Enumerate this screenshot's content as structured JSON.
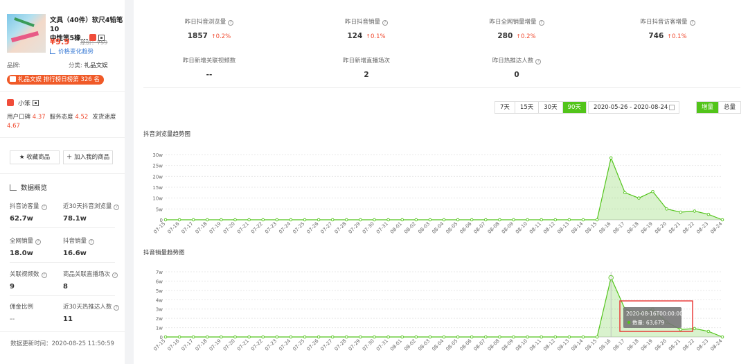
{
  "product": {
    "title_line1": "文具（40件）软尺4铅笔10",
    "title_line2": "中性笔5橡...",
    "price": "¥9.9",
    "orig_price": "原价：¥59",
    "price_trend_label": "价格变化趋势"
  },
  "brand": {
    "label": "品牌:",
    "category_label": "分类:",
    "category": "礼品文娱"
  },
  "rank_badge": "礼品文娱 排行榜日榜第 326 名",
  "shop": {
    "name": "小笨",
    "score_label_1": "用户口碑",
    "score_1": "4.37",
    "score_label_2": "服务态度",
    "score_2": "4.52",
    "score_label_3": "发货速度",
    "score_3": "4.67"
  },
  "buttons": {
    "favorite": "★ 收藏商品",
    "add": "＋ 加入我的商品"
  },
  "overview": {
    "title": "数据概览",
    "stats": [
      {
        "label": "抖音访客量",
        "value": "62.7w",
        "q": true
      },
      {
        "label": "近30天抖音浏览量",
        "value": "78.1w",
        "q": true
      },
      {
        "label": "全网销量",
        "value": "18.0w",
        "q": true
      },
      {
        "label": "抖音销量",
        "value": "16.6w",
        "q": true
      },
      {
        "label": "关联视频数",
        "value": "9",
        "q": true
      },
      {
        "label": "商品关联直播场次",
        "value": "8",
        "q": true
      },
      {
        "label": "佣金比例",
        "value": "--",
        "q": false
      },
      {
        "label": "近30天热推达人数",
        "value": "11",
        "q": true
      }
    ],
    "updated": "数据更新时间：2020-08-25 11:50:59"
  },
  "topstats": [
    {
      "label": "昨日抖音浏览量",
      "value": "1857",
      "pct": "0.2%",
      "q": true
    },
    {
      "label": "昨日抖音销量",
      "value": "124",
      "pct": "0.1%",
      "q": true
    },
    {
      "label": "昨日全网销量增量",
      "value": "280",
      "pct": "0.2%",
      "q": true
    },
    {
      "label": "昨日抖音访客增量",
      "value": "746",
      "pct": "0.1%",
      "q": true
    },
    {
      "label": "昨日新增关联视频数",
      "value": "--",
      "pct": "",
      "q": false
    },
    {
      "label": "昨日新增直播场次",
      "value": "2",
      "pct": "",
      "q": false
    },
    {
      "label": "昨日热推达人数",
      "value": "0",
      "pct": "",
      "q": true
    }
  ],
  "range_buttons": [
    "7天",
    "15天",
    "30天",
    "90天"
  ],
  "range_active": 3,
  "date_range": "2020-05-26 - 2020-08-24",
  "mode_buttons": [
    "增量",
    "总量"
  ],
  "mode_active": 0,
  "accent_color": "#52c41a",
  "chart_data": [
    {
      "type": "area",
      "title": "抖音浏览量趋势图",
      "x": [
        "07-15",
        "07-16",
        "07-17",
        "07-18",
        "07-19",
        "07-20",
        "07-21",
        "07-22",
        "07-23",
        "07-24",
        "07-25",
        "07-26",
        "07-27",
        "07-28",
        "07-29",
        "07-30",
        "07-31",
        "08-01",
        "08-02",
        "08-03",
        "08-04",
        "08-05",
        "08-06",
        "08-07",
        "08-08",
        "08-09",
        "08-10",
        "08-11",
        "08-12",
        "08-13",
        "08-14",
        "08-15",
        "08-16",
        "08-17",
        "08-18",
        "08-19",
        "08-20",
        "08-21",
        "08-22",
        "08-23",
        "08-24"
      ],
      "values": [
        0,
        0,
        0,
        0,
        0,
        0,
        0,
        0,
        0,
        0,
        0,
        0,
        0,
        0,
        0,
        0,
        0,
        0,
        0,
        0,
        0,
        0,
        0,
        0,
        0,
        0,
        0,
        0,
        0,
        0,
        0,
        0,
        28.5,
        12.5,
        10,
        13,
        5,
        3.5,
        4,
        2.5,
        0
      ],
      "ylim": [
        0,
        30
      ],
      "yticks": [
        "0",
        "5w",
        "10w",
        "15w",
        "20w",
        "25w",
        "30w"
      ],
      "grid": true,
      "color": "#52c41a"
    },
    {
      "type": "area",
      "title": "抖音销量趋势图",
      "x": [
        "07-15",
        "07-16",
        "07-17",
        "07-18",
        "07-19",
        "07-20",
        "07-21",
        "07-22",
        "07-23",
        "07-24",
        "07-25",
        "07-26",
        "07-27",
        "07-28",
        "07-29",
        "07-30",
        "07-31",
        "08-01",
        "08-02",
        "08-03",
        "08-04",
        "08-05",
        "08-06",
        "08-07",
        "08-08",
        "08-09",
        "08-10",
        "08-11",
        "08-12",
        "08-13",
        "08-14",
        "08-15",
        "08-16",
        "08-17",
        "08-18",
        "08-19",
        "08-20",
        "08-21",
        "08-22",
        "08-23",
        "08-24"
      ],
      "values": [
        0,
        0,
        0,
        0,
        0,
        0,
        0,
        0,
        0,
        0,
        0,
        0,
        0,
        0,
        0,
        0,
        0,
        0,
        0,
        0,
        0,
        0,
        0,
        0,
        0,
        0,
        0,
        0,
        0,
        0,
        0,
        0,
        6.37,
        3,
        2.6,
        3,
        1.6,
        0.8,
        0.9,
        0.6,
        0
      ],
      "ylim": [
        0,
        7
      ],
      "yticks": [
        "0",
        "1w",
        "2w",
        "3w",
        "4w",
        "5w",
        "6w",
        "7w"
      ],
      "grid": true,
      "color": "#52c41a",
      "tooltip": {
        "date": "2020-08-16T00:00:00",
        "label": "数量: 63,679"
      }
    }
  ]
}
